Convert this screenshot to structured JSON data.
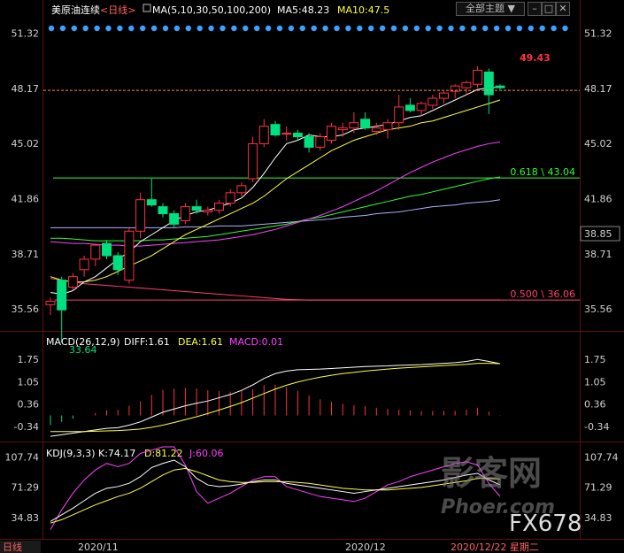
{
  "header": {
    "title": "美原油连续",
    "period": "<日线>",
    "ma_label": "MA(5,10,30,50,100,200)",
    "ma5": "MA5:48.23",
    "ma10": "MA10:47.5",
    "theme_button": "全部主题",
    "dropdown_arrow": "▼"
  },
  "colors": {
    "up": "#ff3040",
    "down": "#00e080",
    "ma5": "#ffffff",
    "ma10": "#ffff40",
    "ma30": "#ff40ff",
    "ma50": "#30ff30",
    "ma100": "#b0b0ff",
    "ma200": "#ff4070",
    "accent_blue": "#3fa0ff"
  },
  "price_axis": {
    "left_ticks": [
      "51.32",
      "48.17",
      "45.02",
      "41.86",
      "38.71",
      "35.56"
    ],
    "right_ticks": [
      "51.32",
      "48.17",
      "45.02",
      "41.86",
      "38.71",
      "35.56"
    ],
    "current_price": "38.85",
    "high_label": "49.43",
    "low_label": "33.64"
  },
  "fib_levels": [
    {
      "label": "0.618 \\ 43.04",
      "value": 43.04,
      "color": "#30ff30"
    },
    {
      "label": "0.500 \\ 36.06",
      "value": 36.06,
      "color": "#ff4070"
    }
  ],
  "date_axis": {
    "label_1": "2020/11",
    "label_2": "2020/12",
    "current_date": "2020/12/22 星期二"
  },
  "macd_panel": {
    "label": "MACD(26,12,9)",
    "diff": "DIFF:1.61",
    "dea": "DEA:1.61",
    "macd": "MACD:0.01",
    "ticks": [
      "1.75",
      "1.05",
      "0.36",
      "-0.34"
    ]
  },
  "kdj_panel": {
    "label": "KDJ(9,3,3)",
    "k": "K:74.17",
    "d": "D:81.22",
    "j": "J:60.06",
    "ticks": [
      "107.74",
      "71.29",
      "34.83"
    ]
  },
  "watermark": {
    "brand": "影客网",
    "site": "Phoer.com",
    "code": "FX678"
  },
  "footer": {
    "corner_label": "日线"
  },
  "chart_data": {
    "type": "candlestick",
    "ylim": [
      34.4,
      51.8
    ],
    "candles": [
      {
        "o": 35.8,
        "h": 36.2,
        "l": 35.2,
        "c": 36.0
      },
      {
        "o": 37.2,
        "h": 37.4,
        "l": 33.64,
        "c": 35.5
      },
      {
        "o": 36.8,
        "h": 37.6,
        "l": 36.6,
        "c": 37.4
      },
      {
        "o": 37.8,
        "h": 38.6,
        "l": 37.4,
        "c": 38.4
      },
      {
        "o": 38.4,
        "h": 39.2,
        "l": 38.0,
        "c": 39.2
      },
      {
        "o": 39.3,
        "h": 39.5,
        "l": 38.4,
        "c": 38.6
      },
      {
        "o": 38.6,
        "h": 38.8,
        "l": 37.5,
        "c": 37.8
      },
      {
        "o": 37.2,
        "h": 40.2,
        "l": 37.0,
        "c": 40.0
      },
      {
        "o": 40.0,
        "h": 42.2,
        "l": 39.6,
        "c": 41.8
      },
      {
        "o": 41.8,
        "h": 43.0,
        "l": 41.4,
        "c": 41.5
      },
      {
        "o": 41.4,
        "h": 41.6,
        "l": 40.8,
        "c": 41.0
      },
      {
        "o": 41.0,
        "h": 41.2,
        "l": 40.2,
        "c": 40.4
      },
      {
        "o": 40.6,
        "h": 41.6,
        "l": 40.4,
        "c": 41.4
      },
      {
        "o": 41.4,
        "h": 41.8,
        "l": 41.0,
        "c": 41.2
      },
      {
        "o": 41.1,
        "h": 41.4,
        "l": 40.9,
        "c": 41.2
      },
      {
        "o": 41.2,
        "h": 41.8,
        "l": 41.0,
        "c": 41.6
      },
      {
        "o": 41.6,
        "h": 42.4,
        "l": 41.4,
        "c": 42.2
      },
      {
        "o": 42.2,
        "h": 42.8,
        "l": 42.0,
        "c": 42.6
      },
      {
        "o": 43.0,
        "h": 45.4,
        "l": 42.8,
        "c": 45.0
      },
      {
        "o": 45.0,
        "h": 46.4,
        "l": 44.8,
        "c": 46.0
      },
      {
        "o": 46.1,
        "h": 46.3,
        "l": 45.4,
        "c": 45.5
      },
      {
        "o": 45.6,
        "h": 46.0,
        "l": 45.2,
        "c": 45.6
      },
      {
        "o": 45.6,
        "h": 45.8,
        "l": 45.2,
        "c": 45.4
      },
      {
        "o": 45.4,
        "h": 45.6,
        "l": 44.5,
        "c": 44.8
      },
      {
        "o": 44.8,
        "h": 45.6,
        "l": 44.6,
        "c": 45.4
      },
      {
        "o": 45.2,
        "h": 46.2,
        "l": 45.0,
        "c": 46.0
      },
      {
        "o": 45.8,
        "h": 46.2,
        "l": 45.4,
        "c": 45.9
      },
      {
        "o": 45.9,
        "h": 46.8,
        "l": 45.6,
        "c": 46.2
      },
      {
        "o": 46.4,
        "h": 46.8,
        "l": 45.8,
        "c": 45.9
      },
      {
        "o": 45.7,
        "h": 46.2,
        "l": 45.5,
        "c": 45.9
      },
      {
        "o": 45.8,
        "h": 46.4,
        "l": 45.3,
        "c": 46.2
      },
      {
        "o": 46.2,
        "h": 47.8,
        "l": 45.8,
        "c": 47.1
      },
      {
        "o": 47.2,
        "h": 47.6,
        "l": 46.8,
        "c": 46.9
      },
      {
        "o": 46.9,
        "h": 47.4,
        "l": 46.6,
        "c": 47.3
      },
      {
        "o": 47.2,
        "h": 47.8,
        "l": 47.0,
        "c": 47.6
      },
      {
        "o": 47.6,
        "h": 48.0,
        "l": 47.3,
        "c": 47.9
      },
      {
        "o": 48.0,
        "h": 48.4,
        "l": 47.6,
        "c": 48.3
      },
      {
        "o": 48.2,
        "h": 48.6,
        "l": 47.8,
        "c": 48.5
      },
      {
        "o": 48.4,
        "h": 49.43,
        "l": 48.2,
        "c": 49.2
      },
      {
        "o": 49.1,
        "h": 49.3,
        "l": 46.7,
        "c": 47.8
      },
      {
        "o": 48.3,
        "h": 48.4,
        "l": 48.1,
        "c": 48.2
      }
    ],
    "ma5": [
      36.5,
      36.4,
      36.6,
      37.1,
      37.4,
      37.9,
      38.4,
      38.8,
      39.4,
      39.8,
      40.2,
      40.6,
      40.9,
      41.1,
      41.2,
      41.4,
      41.6,
      41.9,
      42.5,
      43.3,
      44.2,
      45.0,
      45.2,
      45.5,
      45.4,
      45.4,
      45.5,
      45.8,
      45.9,
      46.0,
      46.1,
      46.3,
      46.5,
      46.6,
      46.9,
      47.2,
      47.5,
      47.8,
      48.1,
      48.2,
      48.23
    ],
    "ma10": [
      37.4,
      37.2,
      37.1,
      37.1,
      37.2,
      37.4,
      37.7,
      38.0,
      38.3,
      38.6,
      39.0,
      39.4,
      39.8,
      40.1,
      40.4,
      40.7,
      41.0,
      41.3,
      41.6,
      42.0,
      42.5,
      43.0,
      43.4,
      43.8,
      44.2,
      44.6,
      44.9,
      45.2,
      45.4,
      45.6,
      45.8,
      45.9,
      46.0,
      46.2,
      46.3,
      46.5,
      46.7,
      46.9,
      47.1,
      47.3,
      47.5
    ],
    "ma30": [
      39.4,
      39.35,
      39.3,
      39.3,
      39.25,
      39.2,
      39.2,
      39.15,
      39.15,
      39.2,
      39.25,
      39.3,
      39.35,
      39.4,
      39.45,
      39.5,
      39.6,
      39.7,
      39.8,
      39.95,
      40.1,
      40.3,
      40.5,
      40.7,
      40.9,
      41.15,
      41.4,
      41.7,
      42.0,
      42.3,
      42.65,
      43.0,
      43.35,
      43.65,
      43.95,
      44.2,
      44.45,
      44.65,
      44.85,
      45.0,
      45.1
    ],
    "ma50": [
      39.6,
      39.6,
      39.55,
      39.5,
      39.45,
      39.45,
      39.45,
      39.45,
      39.45,
      39.5,
      39.5,
      39.55,
      39.6,
      39.65,
      39.7,
      39.8,
      39.9,
      40.0,
      40.1,
      40.2,
      40.3,
      40.4,
      40.55,
      40.7,
      40.8,
      40.95,
      41.1,
      41.25,
      41.4,
      41.55,
      41.7,
      41.85,
      42.0,
      42.1,
      42.25,
      42.4,
      42.55,
      42.7,
      42.85,
      43.0,
      43.1
    ],
    "ma100": [
      40.2,
      40.2,
      40.2,
      40.2,
      40.2,
      40.2,
      40.2,
      40.2,
      40.2,
      40.2,
      40.2,
      40.2,
      40.25,
      40.25,
      40.25,
      40.3,
      40.3,
      40.3,
      40.35,
      40.4,
      40.45,
      40.5,
      40.55,
      40.6,
      40.65,
      40.7,
      40.8,
      40.85,
      40.9,
      41.0,
      41.05,
      41.1,
      41.2,
      41.3,
      41.4,
      41.45,
      41.5,
      41.6,
      41.65,
      41.7,
      41.8
    ],
    "ma200": [
      37.3,
      37.2,
      37.1,
      37.0,
      36.95,
      36.9,
      36.85,
      36.8,
      36.75,
      36.7,
      36.65,
      36.6,
      36.55,
      36.5,
      36.45,
      36.4,
      36.35,
      36.3,
      36.25,
      36.2,
      36.15,
      36.1,
      36.08,
      36.06,
      36.06,
      36.06,
      36.06,
      36.06,
      36.06,
      36.06,
      36.06,
      36.06,
      36.06,
      36.06,
      36.06,
      36.06,
      36.06,
      36.06,
      36.06,
      36.06,
      36.06
    ],
    "macd": {
      "ylim": [
        -0.7,
        2.05
      ],
      "diff": [
        -0.65,
        -0.6,
        -0.55,
        -0.5,
        -0.45,
        -0.4,
        -0.38,
        -0.3,
        -0.2,
        -0.05,
        0.1,
        0.2,
        0.3,
        0.38,
        0.45,
        0.55,
        0.65,
        0.78,
        0.95,
        1.15,
        1.3,
        1.38,
        1.42,
        1.43,
        1.44,
        1.46,
        1.48,
        1.5,
        1.52,
        1.53,
        1.54,
        1.56,
        1.57,
        1.58,
        1.6,
        1.62,
        1.64,
        1.68,
        1.74,
        1.68,
        1.61
      ],
      "dea": [
        -0.5,
        -0.5,
        -0.5,
        -0.5,
        -0.49,
        -0.48,
        -0.47,
        -0.45,
        -0.42,
        -0.37,
        -0.3,
        -0.22,
        -0.13,
        -0.04,
        0.06,
        0.17,
        0.28,
        0.4,
        0.54,
        0.68,
        0.82,
        0.94,
        1.04,
        1.12,
        1.19,
        1.25,
        1.3,
        1.34,
        1.38,
        1.41,
        1.44,
        1.47,
        1.49,
        1.51,
        1.53,
        1.55,
        1.57,
        1.59,
        1.62,
        1.62,
        1.61
      ],
      "hist": [
        -0.3,
        -0.2,
        -0.1,
        0,
        0.08,
        0.16,
        0.18,
        0.3,
        0.44,
        0.64,
        0.8,
        0.84,
        0.86,
        0.84,
        0.78,
        0.76,
        0.74,
        0.76,
        0.82,
        0.94,
        0.96,
        0.88,
        0.76,
        0.62,
        0.5,
        0.42,
        0.36,
        0.32,
        0.28,
        0.24,
        0.2,
        0.18,
        0.16,
        0.14,
        0.14,
        0.14,
        0.14,
        0.18,
        0.24,
        0.12,
        0.01
      ]
    },
    "kdj": {
      "ylim": [
        10,
        120
      ],
      "k": [
        30,
        38,
        46,
        55,
        64,
        70,
        72,
        76,
        84,
        95,
        100,
        104,
        96,
        82,
        74,
        72,
        73,
        75,
        78,
        80,
        80,
        76,
        74,
        72,
        70,
        68,
        66,
        64,
        66,
        68,
        70,
        72,
        74,
        76,
        78,
        80,
        83,
        86,
        88,
        80,
        74.17
      ],
      "d": [
        28,
        32,
        38,
        44,
        50,
        55,
        60,
        64,
        70,
        78,
        86,
        92,
        94,
        90,
        85,
        80,
        78,
        77,
        77,
        78,
        78,
        78,
        77,
        76,
        74,
        72,
        70,
        69,
        68,
        68,
        68,
        69,
        70,
        71,
        73,
        75,
        77,
        79,
        82,
        82,
        81.22
      ],
      "j": [
        20,
        44,
        64,
        80,
        92,
        100,
        96,
        100,
        112,
        116,
        124,
        120,
        98,
        66,
        52,
        58,
        64,
        72,
        80,
        84,
        84,
        72,
        68,
        64,
        60,
        58,
        56,
        54,
        58,
        66,
        74,
        78,
        84,
        88,
        92,
        96,
        100,
        102,
        98,
        76,
        60.06
      ]
    }
  }
}
